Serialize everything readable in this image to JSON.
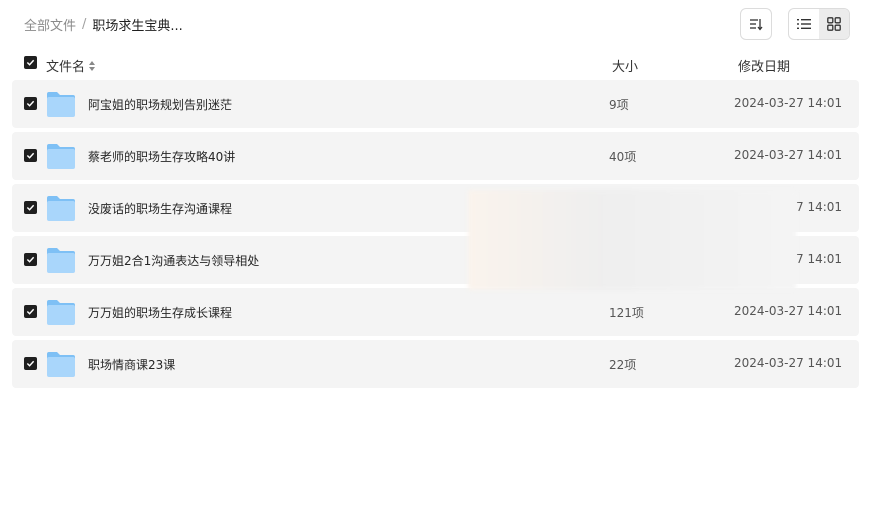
{
  "breadcrumb": {
    "root": "全部文件",
    "separator": "/",
    "current": "职场求生宝典..."
  },
  "toolbar": {
    "sort_icon": "sort-icon",
    "list_view_icon": "list-view-icon",
    "grid_view_icon": "grid-view-icon",
    "active_view": "grid"
  },
  "table": {
    "header": {
      "name": "文件名",
      "size": "大小",
      "date": "修改日期"
    },
    "rows": [
      {
        "name": "阿宝姐的职场规划告别迷茫",
        "size": "9项",
        "date": "2024-03-27 14:01",
        "checked": true
      },
      {
        "name": "蔡老师的职场生存攻略40讲",
        "size": "40项",
        "date": "2024-03-27 14:01",
        "checked": true
      },
      {
        "name": "没废话的职场生存沟通课程",
        "size": "",
        "date": "7 14:01",
        "checked": true
      },
      {
        "name": "万万姐2合1沟通表达与领导相处",
        "size": "",
        "date": "7 14:01",
        "checked": true
      },
      {
        "name": "万万姐的职场生存成长课程",
        "size": "121项",
        "date": "2024-03-27 14:01",
        "checked": true
      },
      {
        "name": "职场情商课23课",
        "size": "22项",
        "date": "2024-03-27 14:01",
        "checked": true
      }
    ]
  },
  "colors": {
    "row_bg": "#f4f4f4",
    "checkbox": "#1f1f1f",
    "folder_light": "#a9d6fb",
    "folder_dark": "#7ec0f5"
  }
}
